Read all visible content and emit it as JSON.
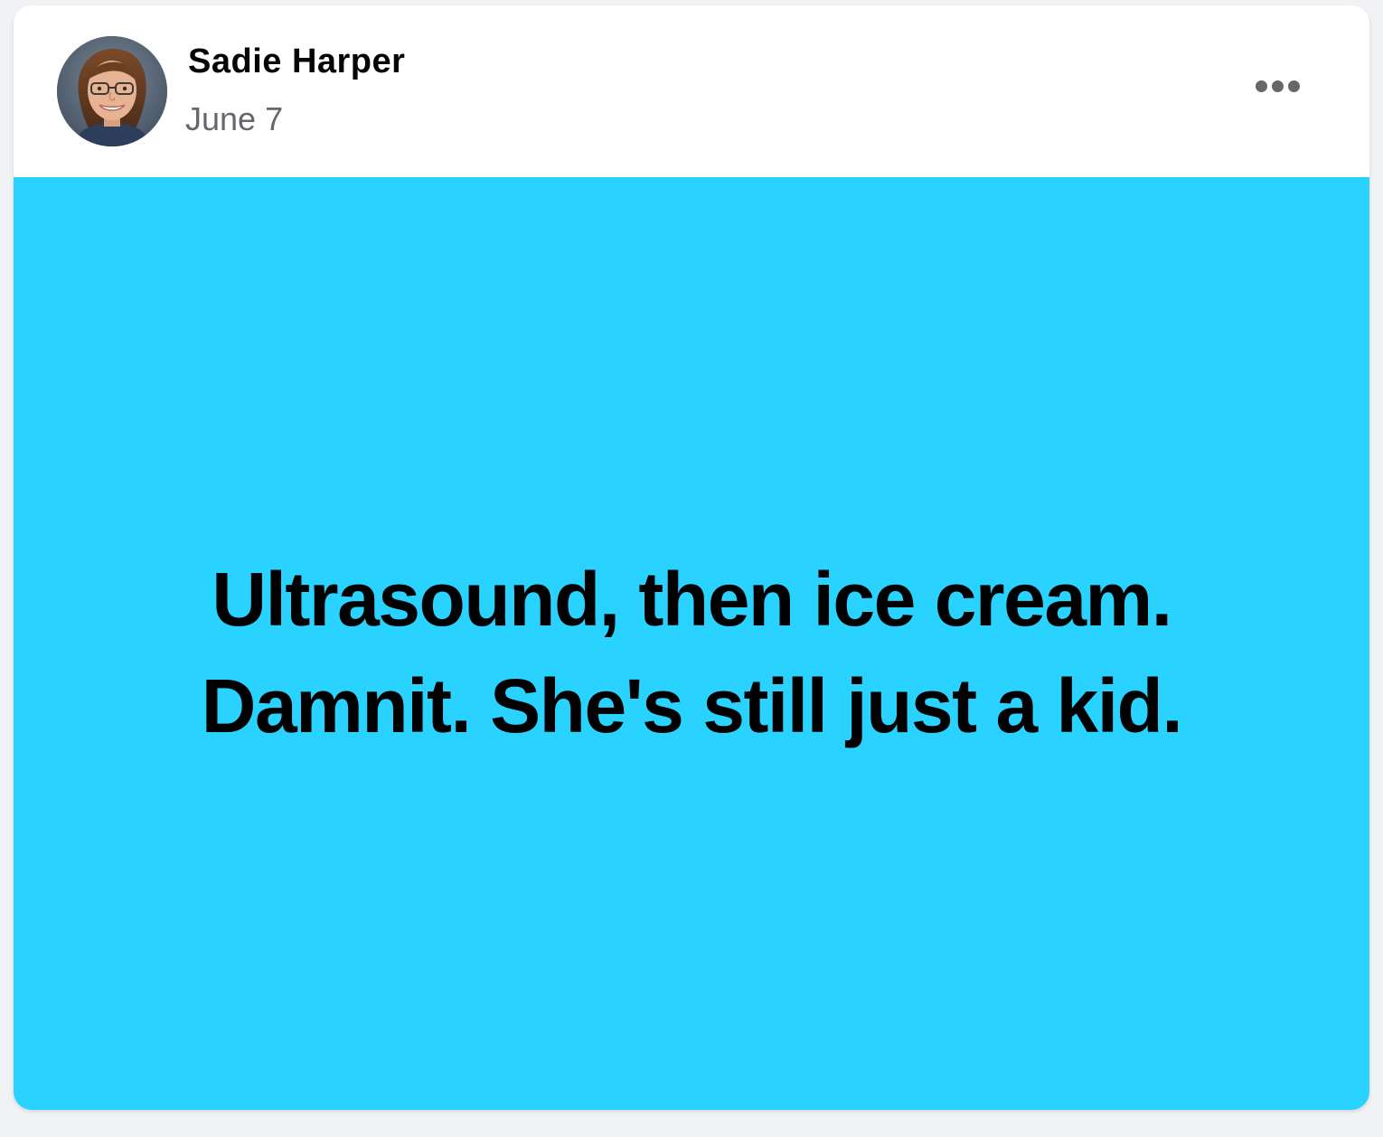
{
  "post": {
    "author": {
      "name": "Sadie Harper",
      "avatar_icon": "user-avatar-photo"
    },
    "date": "June 7",
    "more_icon": "more-options-icon",
    "background_color": "#29d2ff",
    "text_color": "#000000",
    "status_lines": [
      "Ultrasound, then ice cream.",
      "Damnit. She's still just a kid."
    ]
  }
}
